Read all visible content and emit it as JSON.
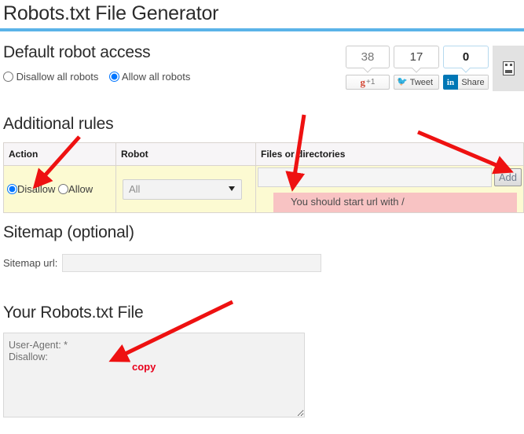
{
  "page": {
    "title": "Robots.txt File Generator",
    "accent_color": "#5bb3e8"
  },
  "default_access": {
    "heading": "Default robot access",
    "options": [
      {
        "label": "Disallow all robots",
        "selected": false
      },
      {
        "label": "Allow all robots",
        "selected": true
      }
    ]
  },
  "social": {
    "gplus": {
      "count": "38",
      "g": "g",
      "plus": "+1"
    },
    "twitter": {
      "count": "17",
      "label": "Tweet"
    },
    "linkedin": {
      "count": "0",
      "badge": "in",
      "label": "Share"
    },
    "broken_image_alt": "broken-image"
  },
  "additional_rules": {
    "heading": "Additional rules",
    "columns": [
      "Action",
      "Robot",
      "Files or directories"
    ],
    "row": {
      "action_options": [
        {
          "label": "Disallow",
          "selected": true
        },
        {
          "label": "Allow",
          "selected": false
        }
      ],
      "robot_value": "All",
      "robot_options": [
        "All"
      ],
      "files_value": "",
      "files_placeholder": "",
      "add_label": "Add",
      "error_message": "You should start url with /"
    }
  },
  "sitemap": {
    "heading": "Sitemap (optional)",
    "label": "Sitemap url:",
    "value": "",
    "placeholder": ""
  },
  "output": {
    "heading": "Your Robots.txt File",
    "content": "User-Agent: *\nDisallow:"
  },
  "annotations": {
    "copy_label": "copy",
    "arrow_color": "#ee1111"
  }
}
